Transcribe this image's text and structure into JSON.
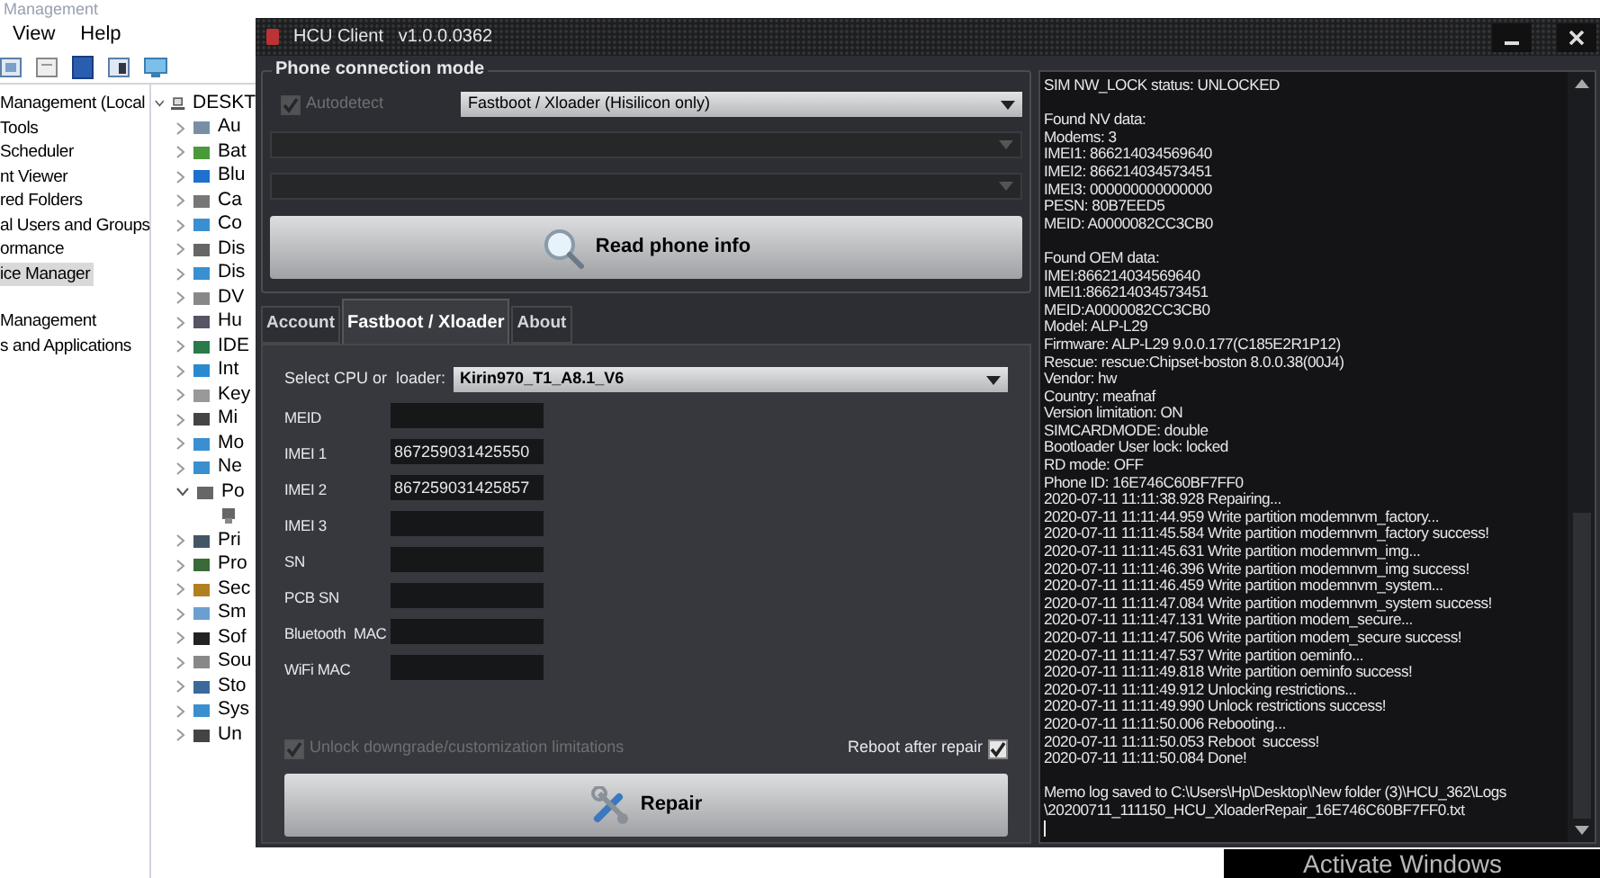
{
  "background_window": {
    "title": "Management",
    "menu": [
      "View",
      "Help"
    ],
    "nav_tree": [
      [
        {
          "label": "Management (Local",
          "selected": false
        },
        {
          "label": "Tools",
          "selected": false
        },
        {
          "label": "Scheduler",
          "selected": false
        },
        {
          "label": "nt Viewer",
          "selected": false
        },
        {
          "label": "red Folders",
          "selected": false
        },
        {
          "label": "al Users and Groups",
          "selected": false
        },
        {
          "label": "ormance",
          "selected": false
        },
        {
          "label": "ice Manager",
          "selected": true
        }
      ],
      [
        {
          "label": "Management",
          "selected": false
        },
        {
          "label": "s and Applications",
          "selected": false
        }
      ]
    ],
    "device_tree": {
      "label": "DESKT",
      "expanded": true,
      "children": [
        {
          "label": "Au",
          "expanded": false
        },
        {
          "label": "Bat",
          "expanded": false
        },
        {
          "label": "Blu",
          "expanded": false
        },
        {
          "label": "Ca",
          "expanded": false
        },
        {
          "label": "Co",
          "expanded": false
        },
        {
          "label": "Dis",
          "expanded": false
        },
        {
          "label": "Dis",
          "expanded": false
        },
        {
          "label": "DV",
          "expanded": false
        },
        {
          "label": "Hu",
          "expanded": false
        },
        {
          "label": "IDE",
          "expanded": false
        },
        {
          "label": "Int",
          "expanded": false
        },
        {
          "label": "Key",
          "expanded": false
        },
        {
          "label": "Mi",
          "expanded": false
        },
        {
          "label": "Mo",
          "expanded": false
        },
        {
          "label": "Ne",
          "expanded": false
        },
        {
          "label": "Po",
          "expanded": true,
          "children": [
            {
              "kind": "device"
            }
          ]
        },
        {
          "label": "Pri",
          "expanded": false
        },
        {
          "label": "Pro",
          "expanded": false
        },
        {
          "label": "Sec",
          "expanded": false
        },
        {
          "label": "Sm",
          "expanded": false
        },
        {
          "label": "Sof",
          "expanded": false
        },
        {
          "label": "Sou",
          "expanded": false
        },
        {
          "label": "Sto",
          "expanded": false
        },
        {
          "label": "Sys",
          "expanded": false
        },
        {
          "label": "Un",
          "expanded": false
        }
      ]
    }
  },
  "hcu": {
    "title": "HCU Client   v1.0.0.0362",
    "connection": {
      "legend": "Phone connection mode",
      "autodetect": {
        "label": "Autodetect",
        "checked": true,
        "disabled": true
      },
      "mode": "Fastboot / Xloader (Hisilicon only)",
      "port_dropdowns": [
        {
          "disabled": true
        },
        {
          "disabled": true
        }
      ]
    },
    "read_button": "Read phone info",
    "tabs": [
      {
        "label": "Account",
        "selected": false
      },
      {
        "label": "Fastboot / Xloader",
        "selected": true
      },
      {
        "label": "About",
        "selected": false
      }
    ],
    "cpu": {
      "label": "Select CPU or  loader:",
      "value": "Kirin970_T1_A8.1_V6"
    },
    "fields": [
      {
        "label": "MEID"
      },
      {
        "label": "IMEI 1",
        "value": "867259031425550"
      },
      {
        "label": "IMEI 2",
        "value": "867259031425857"
      },
      {
        "label": "IMEI 3"
      },
      {
        "label": "SN"
      },
      {
        "label": "PCB SN"
      },
      {
        "label": "Bluetooth  MAC"
      },
      {
        "label": "WiFi MAC"
      }
    ],
    "unlock": {
      "label": "Unlock downgrade/customization limitations",
      "checked": true,
      "disabled": true
    },
    "reboot": {
      "label": "Reboot after repair",
      "checked": true,
      "disabled": false
    },
    "repair_button": "Repair",
    "log": [
      [
        "SIM NW_LOCK status: UNLOCKED"
      ],
      [
        "Found NV data:",
        "Modems: 3",
        "IMEI1: 866214034569640",
        "IMEI2: 866214034573451",
        "IMEI3: 000000000000000",
        "PESN: 80B7EED5",
        "MEID: A0000082CC3CB0"
      ],
      [
        "Found OEM data:",
        "IMEI:866214034569640",
        "IMEI1:866214034573451",
        "MEID:A0000082CC3CB0",
        "Model: ALP-L29",
        "Firmware: ALP-L29 9.0.0.177(C185E2R1P12)",
        "Rescue: rescue:Chipset-boston 8.0.0.38(00J4)",
        "Vendor: hw",
        "Country: meafnaf",
        "Version limitation: ON",
        "SIMCARDMODE: double",
        "Bootloader User lock: locked",
        "RD mode: OFF",
        "Phone ID: 16E746C60BF7FF0",
        "2020-07-11 11:11:38.928 Repairing...",
        "2020-07-11 11:11:44.959 Write partition modemnvm_factory...",
        "2020-07-11 11:11:45.584 Write partition modemnvm_factory success!",
        "2020-07-11 11:11:45.631 Write partition modemnvm_img...",
        "2020-07-11 11:11:46.396 Write partition modemnvm_img success!",
        "2020-07-11 11:11:46.459 Write partition modemnvm_system...",
        "2020-07-11 11:11:47.084 Write partition modemnvm_system success!",
        "2020-07-11 11:11:47.131 Write partition modem_secure...",
        "2020-07-11 11:11:47.506 Write partition modem_secure success!",
        "2020-07-11 11:11:47.537 Write partition oeminfo...",
        "2020-07-11 11:11:49.818 Write partition oeminfo success!",
        "2020-07-11 11:11:49.912 Unlocking restrictions...",
        "2020-07-11 11:11:49.990 Unlock restrictions success!",
        "2020-07-11 11:11:50.006 Rebooting...",
        "2020-07-11 11:11:50.053 Reboot  success!",
        "2020-07-11 11:11:50.084 Done!"
      ],
      [
        "Memo log saved to C:\\Users\\Hp\\Desktop\\New folder (3)\\HCU_362\\Logs",
        "\\20200711_111150_HCU_XloaderRepair_16E746C60BF7FF0.txt"
      ]
    ]
  },
  "activation_notice": "Activate Windows"
}
